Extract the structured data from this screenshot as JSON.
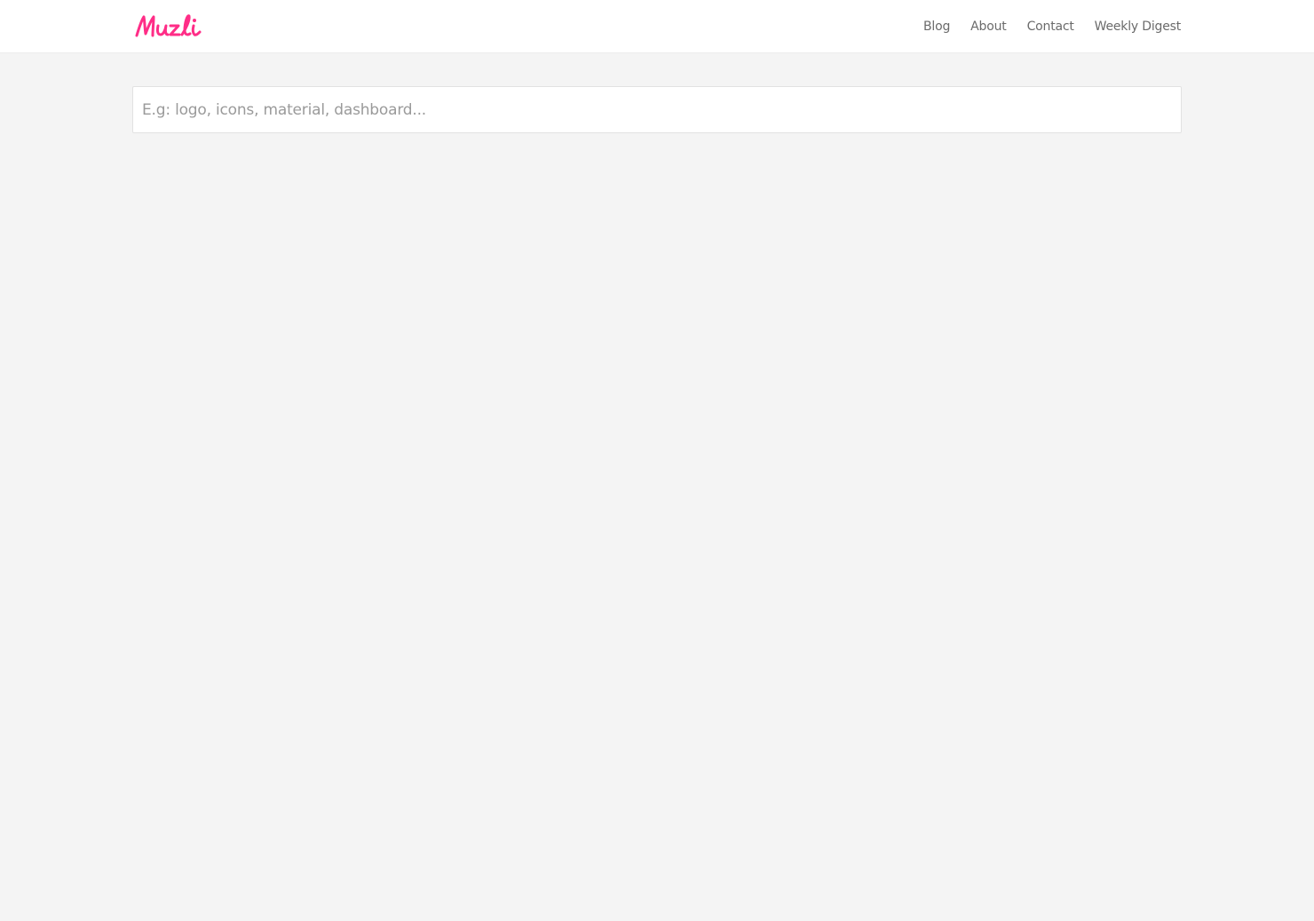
{
  "header": {
    "logo_text": "Muzli",
    "brand_color": "#ff2d87",
    "nav": [
      {
        "label": "Blog"
      },
      {
        "label": "About"
      },
      {
        "label": "Contact"
      },
      {
        "label": "Weekly Digest"
      }
    ]
  },
  "search": {
    "value": "",
    "placeholder": "E.g: logo, icons, material, dashboard..."
  },
  "colors": {
    "background": "#f4f4f4",
    "topbar": "#ffffff",
    "nav_text": "#6b6b6b"
  }
}
